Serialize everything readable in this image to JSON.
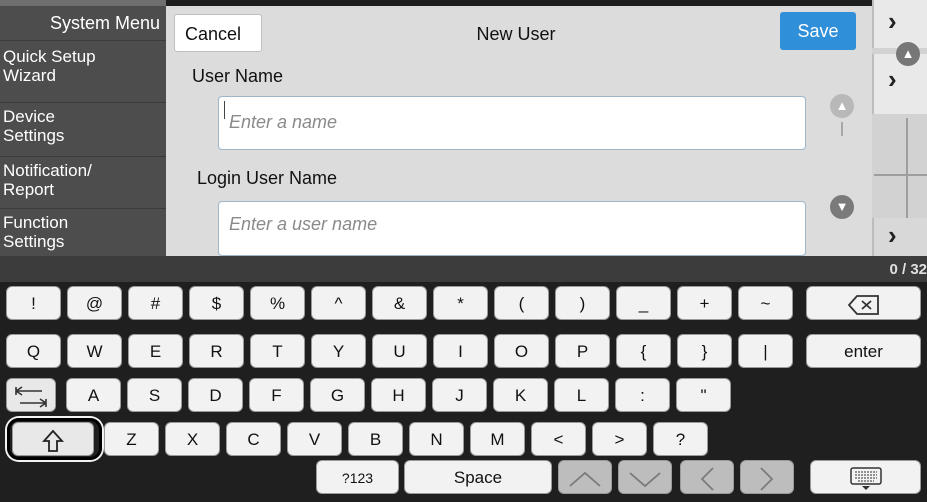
{
  "sidebar": {
    "title": "System Menu",
    "items": [
      {
        "label_line1": "Quick Setup",
        "label_line2": "Wizard"
      },
      {
        "label_line1": "Device",
        "label_line2": "Settings"
      },
      {
        "label_line1": "Notification/",
        "label_line2": "Report"
      },
      {
        "label_line1": "Function",
        "label_line2": "Settings"
      }
    ]
  },
  "dialog": {
    "cancel_label": "Cancel",
    "title": "New User",
    "save_label": "Save",
    "fields": [
      {
        "label": "User Name",
        "placeholder": "Enter a name",
        "value": ""
      },
      {
        "label": "Login User Name",
        "placeholder": "Enter a user name",
        "value": ""
      }
    ]
  },
  "keyboard": {
    "char_count": "0 / 32",
    "rows": [
      [
        "!",
        "@",
        "#",
        "$",
        "%",
        "^",
        "&",
        "*",
        "(",
        ")",
        "_",
        "+",
        "~"
      ],
      [
        "Q",
        "W",
        "E",
        "R",
        "T",
        "Y",
        "U",
        "I",
        "O",
        "P",
        "{",
        "}",
        "|"
      ],
      [
        "A",
        "S",
        "D",
        "F",
        "G",
        "H",
        "J",
        "K",
        "L",
        ":",
        "\""
      ],
      [
        "Z",
        "X",
        "C",
        "V",
        "B",
        "N",
        "M",
        "<",
        ">",
        "?"
      ]
    ],
    "enter_label": "enter",
    "numeric_label": "?123",
    "space_label": "Space",
    "icons": {
      "backspace": "backspace-icon",
      "tab": "tab-icon",
      "shift": "shift-icon",
      "up": "up-arrow-icon",
      "down": "down-arrow-icon",
      "left": "left-arrow-icon",
      "right": "right-arrow-icon",
      "hide": "keyboard-hide-icon"
    }
  },
  "colors": {
    "accent": "#2f8fd8",
    "sidebar": "#4d4d4d",
    "keyboard_bg": "#1f1f1f",
    "scroll_button": "#888888"
  }
}
